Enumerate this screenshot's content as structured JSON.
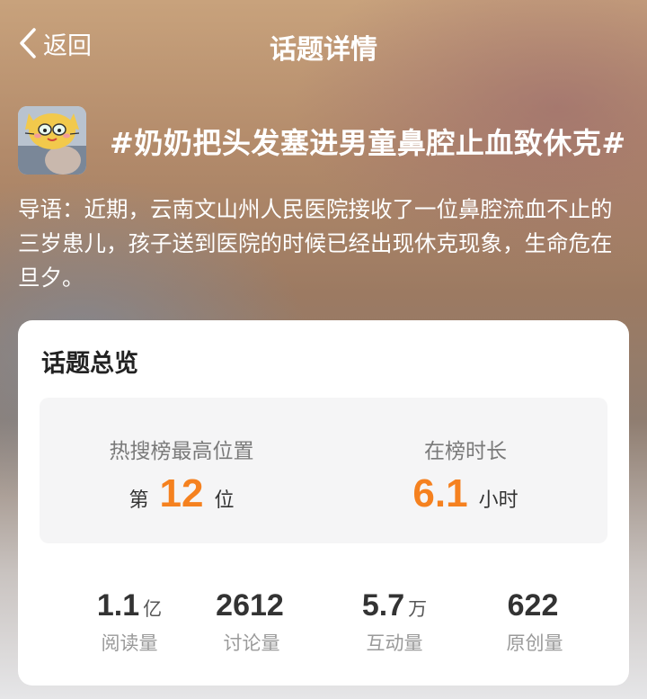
{
  "nav": {
    "back_label": "返回",
    "title": "话题详情"
  },
  "topic": {
    "title": "#奶奶把头发塞进男童鼻腔止血致休克#",
    "intro": "导语：近期，云南文山州人民医院接收了一位鼻腔流血不止的三岁患儿，孩子送到医院的时候已经出现休克现象，生命危在旦夕。"
  },
  "overview": {
    "title": "话题总览",
    "rank": {
      "label": "热搜榜最高位置",
      "prefix": "第",
      "value": "12",
      "suffix": "位"
    },
    "duration": {
      "label": "在榜时长",
      "value": "6.1",
      "unit": "小时"
    },
    "metrics": [
      {
        "value": "1.1",
        "unit": "亿",
        "label": "阅读量"
      },
      {
        "value": "2612",
        "unit": "",
        "label": "讨论量"
      },
      {
        "value": "5.7",
        "unit": "万",
        "label": "互动量"
      },
      {
        "value": "622",
        "unit": "",
        "label": "原创量"
      }
    ]
  },
  "colors": {
    "accent": "#f5811f",
    "card": "#ffffff",
    "panel": "#f5f5f6"
  },
  "icons": {
    "back": "chevron-left-icon",
    "avatar": "cat-sticker-avatar"
  }
}
